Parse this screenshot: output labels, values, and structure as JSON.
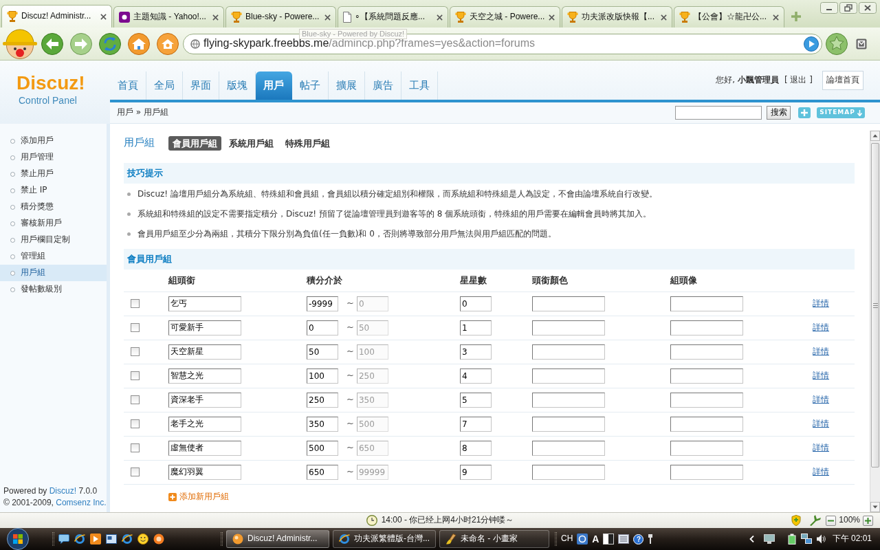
{
  "browser": {
    "tabs": [
      {
        "title": "Discuz! Administr...",
        "kind": "trophy",
        "selected": true
      },
      {
        "title": "主題知識 - Yahoo!...",
        "kind": "logo",
        "selected": false
      },
      {
        "title": "Blue-sky - Powere...",
        "kind": "trophy",
        "selected": false
      },
      {
        "title": "∘【系統問題反應...",
        "kind": "page",
        "selected": false
      },
      {
        "title": "天空之城 - Powere...",
        "kind": "trophy",
        "selected": false
      },
      {
        "title": "功夫派改版快報【...",
        "kind": "trophy",
        "selected": false
      },
      {
        "title": "【公會】☆龍卍公...",
        "kind": "trophy",
        "selected": false
      }
    ],
    "tooltip": "Blue-sky - Powered by Discuz!",
    "address": {
      "host": "flying-skypark.freebbs.me",
      "path": "/admincp.php?frames=yes&action=forums"
    }
  },
  "header": {
    "logo": "Discuz!",
    "logo_subtitle": "Control Panel",
    "nav": [
      {
        "label": "首頁",
        "selected": false
      },
      {
        "label": "全局",
        "selected": false
      },
      {
        "label": "界面",
        "selected": false
      },
      {
        "label": "版塊",
        "selected": false
      },
      {
        "label": "用戶",
        "selected": true
      },
      {
        "label": "帖子",
        "selected": false
      },
      {
        "label": "擴展",
        "selected": false
      },
      {
        "label": "廣告",
        "selected": false
      },
      {
        "label": "工具",
        "selected": false
      }
    ],
    "greeting": "您好, **小飄管理員**",
    "logout": "[ 退出 ]",
    "forum_home": "論壇首頁",
    "breadcrumb": "用戶 » 用戶組",
    "search_button": "搜索",
    "sitemap": "SITEMAP"
  },
  "sidebar": {
    "items": [
      {
        "label": "添加用戶",
        "selected": false
      },
      {
        "label": "用戶管理",
        "selected": false
      },
      {
        "label": "禁止用戶",
        "selected": false
      },
      {
        "label": "禁止 IP",
        "selected": false
      },
      {
        "label": "積分獎懲",
        "selected": false
      },
      {
        "label": "審核新用戶",
        "selected": false
      },
      {
        "label": "用戶欄目定制",
        "selected": false
      },
      {
        "label": "管理組",
        "selected": false
      },
      {
        "label": "用戶組",
        "selected": true
      },
      {
        "label": "發帖數級別",
        "selected": false
      }
    ],
    "footer": [
      {
        "text": "Powered by",
        "link": "Discuz!",
        "after": "7.0.0"
      },
      {
        "text": "© 2001-2009,",
        "link": "Comsenz Inc."
      }
    ]
  },
  "main": {
    "title": "用戶組",
    "tabs": [
      {
        "label": "會員用戶組",
        "selected": true
      },
      {
        "label": "系統用戶組",
        "selected": false
      },
      {
        "label": "特殊用戶組",
        "selected": false
      }
    ],
    "tips": {
      "title": "技巧提示",
      "items": [
        "Discuz! 論壇用戶組分為系統組、特殊組和會員組，會員組以積分確定組別和權限，而系統組和特殊組是人為設定，不會由論壇系統自行改變。",
        "系統組和特殊組的設定不需要指定積分，Discuz! 預留了從論壇管理員到遊客等的 8 個系統頭銜，特殊組的用戶需要在編輯會員時將其加入。",
        "會員用戶組至少分為兩組，其積分下限分別為負值(任一負數)和 0，否則將導致部分用戶無法與用戶組匹配的問題。"
      ]
    },
    "member_groups": {
      "title": "會員用戶組",
      "columns": [
        "組頭銜",
        "積分介於",
        "星星數",
        "頭銜顏色",
        "組頭像"
      ],
      "rows": [
        {
          "checked": false,
          "title": "乞丐",
          "min": "-9999",
          "separator": "~",
          "max": "0",
          "max_disabled": true,
          "star_count": "0",
          "detail": "詳情"
        },
        {
          "checked": false,
          "title": "可愛新手",
          "min": "0",
          "separator": "~",
          "max": "50",
          "max_disabled": true,
          "star_count": "1",
          "detail": "詳情"
        },
        {
          "checked": false,
          "title": "天空新星",
          "min": "50",
          "separator": "~",
          "max": "100",
          "max_disabled": true,
          "star_count": "3",
          "detail": "詳情"
        },
        {
          "checked": false,
          "title": "智慧之光",
          "min": "100",
          "separator": "~",
          "max": "250",
          "max_disabled": true,
          "star_count": "4",
          "detail": "詳情"
        },
        {
          "checked": false,
          "title": "資深老手",
          "min": "250",
          "separator": "~",
          "max": "350",
          "max_disabled": true,
          "star_count": "5",
          "detail": "詳情"
        },
        {
          "checked": false,
          "title": "老手之光",
          "min": "350",
          "separator": "~",
          "max": "500",
          "max_disabled": true,
          "star_count": "7",
          "detail": "詳情"
        },
        {
          "checked": false,
          "title": "虛無使者",
          "min": "500",
          "separator": "~",
          "max": "650",
          "max_disabled": true,
          "star_count": "8",
          "detail": "詳情"
        },
        {
          "checked": false,
          "title": "魔幻羽翼",
          "min": "650",
          "separator": "~",
          "max": "99999",
          "max_disabled": true,
          "star_count": "9",
          "detail": "詳情"
        }
      ],
      "add_link": "添加新用戶組"
    }
  },
  "status_bar": {
    "message": "14:00 - 你已经上网4小时21分钟喽～",
    "zoom": "100%"
  },
  "taskbar": {
    "tasks": [
      {
        "title": "Discuz! Administr...",
        "kind": "ball",
        "selected": true
      },
      {
        "title": "功夫派繁體版-台灣...",
        "kind": "browser",
        "selected": false
      },
      {
        "title": "未命名 - 小畫家",
        "kind": "paint",
        "selected": false
      }
    ],
    "language": "CH",
    "ime": "A",
    "help": "?",
    "clock": "下午 02:01"
  }
}
